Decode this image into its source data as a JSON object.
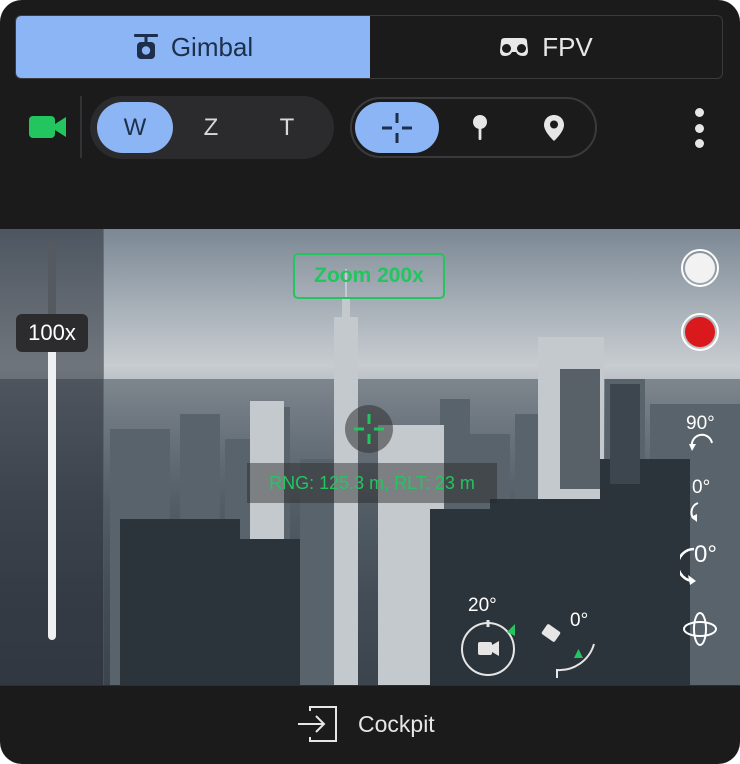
{
  "tabs": [
    {
      "label": "Gimbal",
      "icon": "gimbal-icon",
      "active": true
    },
    {
      "label": "FPV",
      "icon": "fpv-goggles-icon",
      "active": false
    }
  ],
  "camera": {
    "icon": "video-camera-icon",
    "color": "#22c55e"
  },
  "lens_modes": [
    {
      "label": "W",
      "active": true
    },
    {
      "label": "Z",
      "active": false
    },
    {
      "label": "T",
      "active": false
    }
  ],
  "target_modes": [
    {
      "icon": "crosshair-icon",
      "active": true
    },
    {
      "icon": "pin-icon",
      "active": false
    },
    {
      "icon": "location-pin-icon",
      "active": false
    }
  ],
  "more_menu": {
    "icon": "more-vertical-icon"
  },
  "viewport": {
    "zoom_value": "100x",
    "zoom_level_fraction": 0.8,
    "zoom_overlay": "Zoom 200x",
    "range_text": "RNG: 125.3 m, RLT: 23 m",
    "camera_heading": "20°",
    "gimbal_pitch": "0°",
    "controls": {
      "photo_button": "shutter-icon",
      "record_button": "record-icon",
      "rotate_90": "90°",
      "rotate_0": "0°",
      "roll_0": "0°",
      "recenter": "recenter-gimbal-icon"
    }
  },
  "footer": {
    "label": "Cockpit",
    "icon": "enter-icon"
  },
  "colors": {
    "accent": "#8cb5f5",
    "green": "#22c55e",
    "record": "#d9191c"
  }
}
